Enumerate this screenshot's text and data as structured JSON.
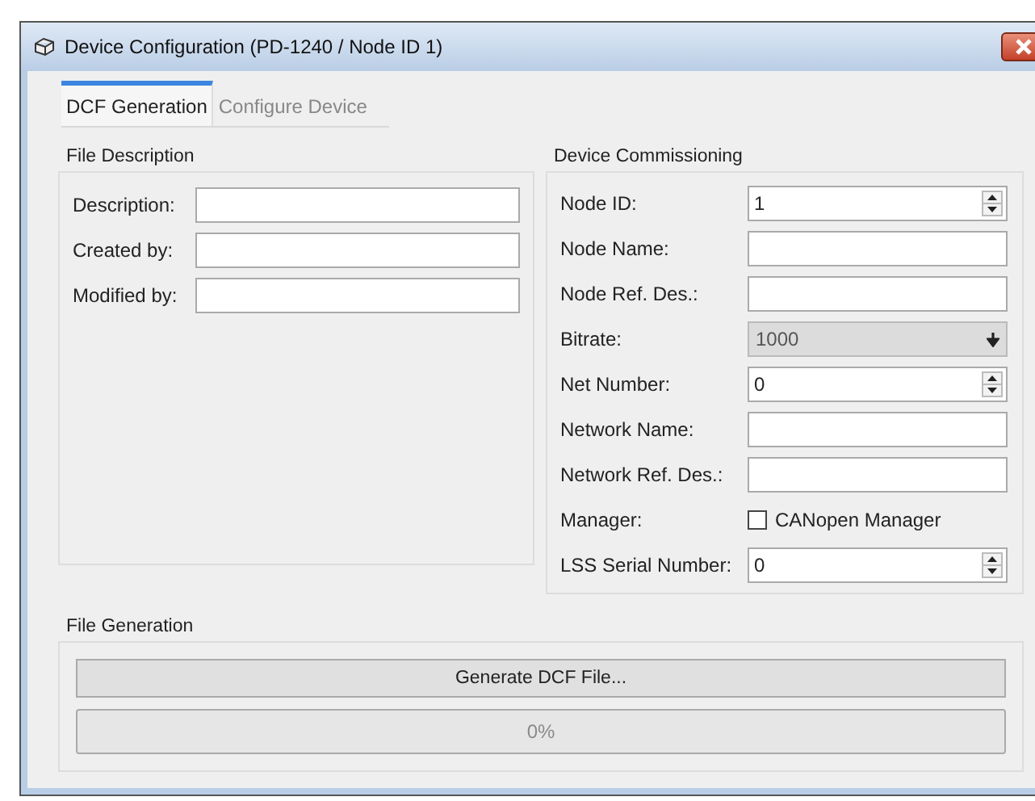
{
  "window": {
    "title": "Device Configuration (PD-1240 / Node ID  1)"
  },
  "tabs": [
    {
      "label": "DCF Generation",
      "selected": true
    },
    {
      "label": "Configure Device",
      "selected": false
    }
  ],
  "file_description": {
    "title": "File Description",
    "fields": [
      {
        "label": "Description:"
      },
      {
        "label": "Created by:"
      },
      {
        "label": "Modified by:"
      }
    ]
  },
  "device_commissioning": {
    "title": "Device Commissioning",
    "fields": [
      {
        "kind": "spin",
        "label": "Node ID:",
        "value": "1"
      },
      {
        "kind": "text",
        "label": "Node Name:"
      },
      {
        "kind": "text",
        "label": "Node Ref. Des.:"
      },
      {
        "kind": "dropdown",
        "label": "Bitrate:",
        "value": "1000"
      },
      {
        "kind": "spin",
        "label": "Net Number:",
        "value": "0"
      },
      {
        "kind": "text",
        "label": "Network Name:"
      },
      {
        "kind": "text",
        "label": "Network Ref. Des.:"
      },
      {
        "kind": "checkbox",
        "label": "Manager:",
        "option": "CANopen Manager",
        "checked": false
      },
      {
        "kind": "spin",
        "label": "LSS Serial Number:",
        "value": "0"
      }
    ]
  },
  "file_generation": {
    "title": "File Generation",
    "button": "Generate DCF File...",
    "progress": {
      "level": 0,
      "text": "0%"
    }
  }
}
